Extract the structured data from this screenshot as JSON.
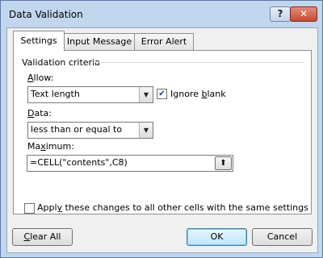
{
  "window": {
    "title": "Data Validation",
    "help_label": "?",
    "close_label": "✕"
  },
  "tabs": [
    {
      "label": "Settings",
      "active": true
    },
    {
      "label": "Input Message",
      "active": false
    },
    {
      "label": "Error Alert",
      "active": false
    }
  ],
  "settings": {
    "section_title": "Validation criteria",
    "allow": {
      "label_pre": "",
      "label_key": "A",
      "label_post": "llow:",
      "value": "Text length"
    },
    "ignore_blank": {
      "label_pre": "Ignore ",
      "label_key": "b",
      "label_post": "lank",
      "checked": true
    },
    "data": {
      "label_pre": "",
      "label_key": "D",
      "label_post": "ata:",
      "value": "less than or equal to"
    },
    "maximum": {
      "label_pre": "Ma",
      "label_key": "x",
      "label_post": "imum:",
      "value": "=CELL(\"contents\",C8)"
    },
    "apply_all": {
      "label_pre": "Appl",
      "label_key": "y",
      "label_post": " these changes to all other cells with the same settings",
      "checked": false
    }
  },
  "buttons": {
    "clear_all": {
      "label_pre": "",
      "label_key": "C",
      "label_post": "lear All"
    },
    "ok": {
      "label": "OK"
    },
    "cancel": {
      "label": "Cancel"
    }
  },
  "icons": {
    "checkmark": "✔",
    "dropdown": "▼",
    "collapse": "⬆"
  }
}
